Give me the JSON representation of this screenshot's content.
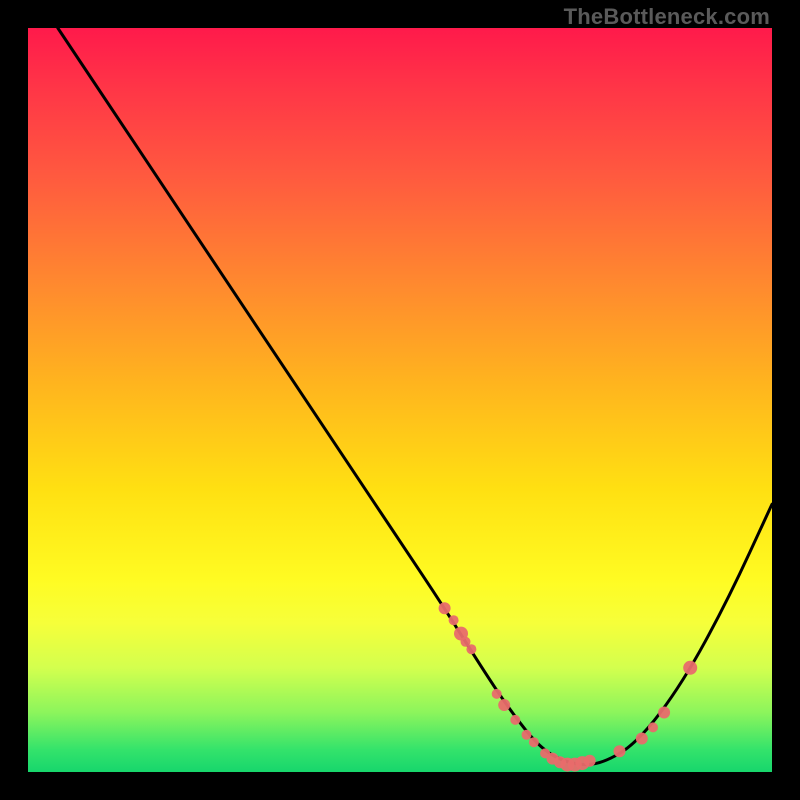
{
  "attribution": "TheBottleneck.com",
  "chart_data": {
    "type": "line",
    "title": "",
    "xlabel": "",
    "ylabel": "",
    "xlim": [
      0,
      100
    ],
    "ylim": [
      0,
      100
    ],
    "series": [
      {
        "name": "bottleneck-curve",
        "x": [
          4,
          10,
          18,
          26,
          34,
          42,
          50,
          56,
          61,
          65,
          69,
          73,
          77,
          82,
          88,
          94,
          100
        ],
        "y": [
          100,
          91,
          79,
          67,
          55,
          43,
          31,
          22,
          14,
          8,
          3,
          1,
          1,
          4,
          12,
          23,
          36
        ]
      }
    ],
    "markers": {
      "name": "highlight-points",
      "color": "#e86b6b",
      "x": [
        56.0,
        57.2,
        58.2,
        58.8,
        59.6,
        63.0,
        64.0,
        65.5,
        67.0,
        68.0,
        69.5,
        70.5,
        71.5,
        72.5,
        73.5,
        74.5,
        75.5,
        79.5,
        82.5,
        84.0,
        85.5,
        89.0
      ],
      "y": [
        22.0,
        20.4,
        18.6,
        17.5,
        16.5,
        10.5,
        9.0,
        7.0,
        5.0,
        4.0,
        2.5,
        1.8,
        1.3,
        1.0,
        1.0,
        1.2,
        1.5,
        2.8,
        4.5,
        6.0,
        8.0,
        14.0
      ],
      "r": [
        6,
        5,
        7,
        5,
        5,
        5,
        6,
        5,
        5,
        5,
        5,
        6,
        6,
        7,
        7,
        7,
        6,
        6,
        6,
        5,
        6,
        7
      ]
    },
    "gradient_stops": [
      {
        "pct": 0,
        "color": "#ff1a4b"
      },
      {
        "pct": 20,
        "color": "#ff5a3f"
      },
      {
        "pct": 48,
        "color": "#ffb51e"
      },
      {
        "pct": 74,
        "color": "#fffb22"
      },
      {
        "pct": 92,
        "color": "#8cf55c"
      },
      {
        "pct": 100,
        "color": "#17d66c"
      }
    ]
  }
}
